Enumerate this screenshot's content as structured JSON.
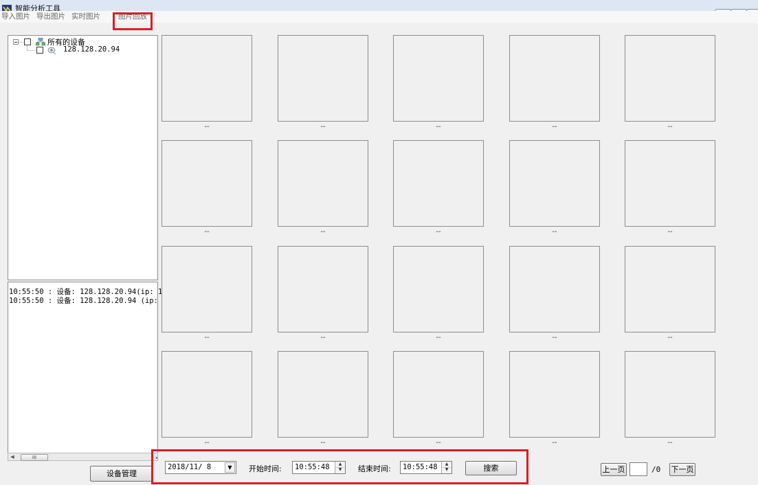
{
  "window": {
    "title": "智能分析工具",
    "controls": {
      "minimize": "▭",
      "maximize": "▣",
      "close": "✕"
    }
  },
  "menu": {
    "items": [
      "导入图片",
      "导出图片",
      "实时图片",
      "图片回放"
    ]
  },
  "tree": {
    "root_label": "所有的设备",
    "devices": [
      "128.128.20.94"
    ]
  },
  "log": {
    "lines": [
      "10:55:50 : 设备: 128.128.20.94(ip: 1",
      "10:55:50 : 设备: 128.128.20.94 (ip:"
    ]
  },
  "scrollbar": {
    "thumb_label": "III"
  },
  "left_panel": {
    "device_mgmt_label": "设备管理"
  },
  "grid": {
    "captions": [
      "--",
      "--",
      "--",
      "--",
      "--",
      "--",
      "--",
      "--",
      "--",
      "--",
      "--",
      "--",
      "--",
      "--",
      "--",
      "--",
      "--",
      "--",
      "--",
      "--"
    ]
  },
  "search": {
    "date_value": "2018/11/ 8",
    "start_label": "开始时间:",
    "start_value": "10:55:48",
    "end_label": "结束时间:",
    "end_value": "10:55:48",
    "search_label": "搜索"
  },
  "pager": {
    "prev_label": "上一页",
    "page_input": "",
    "total_label": "/0",
    "next_label": "下一页"
  },
  "colors": {
    "highlight": "#e01b23",
    "titlebar": "#dde6f3"
  }
}
